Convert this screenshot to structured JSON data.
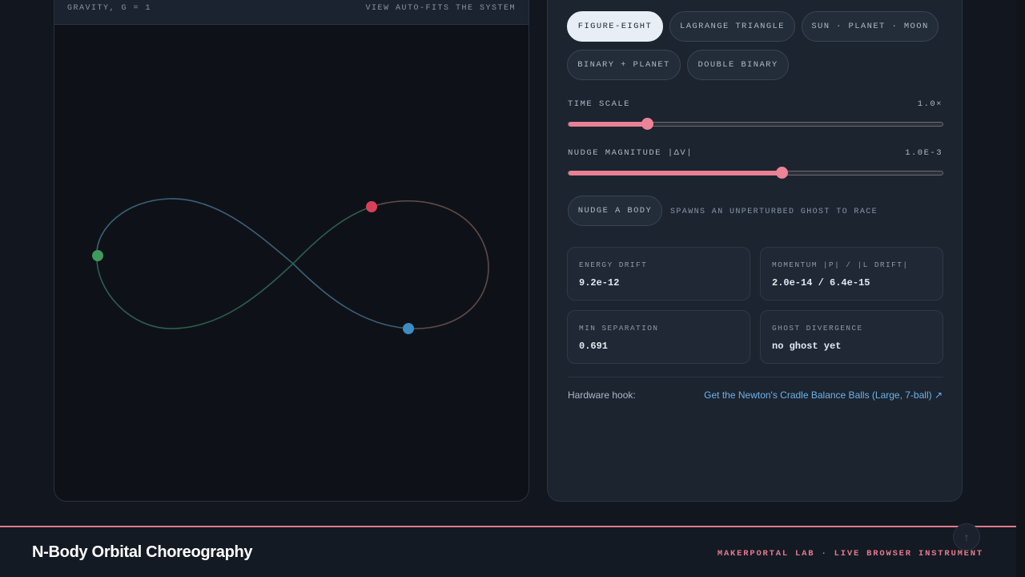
{
  "canvas": {
    "gravity_label": "GRAVITY, G = 1",
    "view_label": "VIEW AUTO-FITS THE SYSTEM",
    "bodies": [
      {
        "name": "red",
        "color": "#d8405a"
      },
      {
        "name": "green",
        "color": "#3e9b5c"
      },
      {
        "name": "blue",
        "color": "#3b8dc4"
      }
    ]
  },
  "presets": {
    "figure_eight": "FIGURE-EIGHT",
    "lagrange_triangle": "LAGRANGE TRIANGLE",
    "sun_planet_moon": "SUN · PLANET · MOON",
    "binary_planet": "BINARY + PLANET",
    "double_binary": "DOUBLE BINARY",
    "active": "FIGURE-EIGHT"
  },
  "sliders": {
    "time_scale": {
      "label": "TIME SCALE",
      "value_text": "1.0×",
      "fraction": 0.21
    },
    "nudge_magnitude": {
      "label": "NUDGE MAGNITUDE |ΔV|",
      "value_text": "1.0E-3",
      "fraction": 0.57
    }
  },
  "nudge": {
    "button_label": "NUDGE A BODY",
    "note": "SPAWNS AN UNPERTURBED GHOST TO RACE"
  },
  "stats": {
    "energy_drift": {
      "label": "ENERGY DRIFT",
      "value": "9.2e-12"
    },
    "momentum": {
      "label": "MOMENTUM |P| / |L DRIFT|",
      "value": "2.0e-14 / 6.4e-15"
    },
    "min_separation": {
      "label": "MIN SEPARATION",
      "value": "0.691"
    },
    "ghost_divergence": {
      "label": "GHOST DIVERGENCE",
      "value": "no ghost yet"
    }
  },
  "hardware": {
    "label": "Hardware hook:",
    "link_text": "Get the Newton's Cradle Balance Balls (Large, 7-ball) ↗"
  },
  "footer": {
    "title": "N-Body Orbital Choreography",
    "credit": "MAKERPORTAL LAB · LIVE BROWSER INSTRUMENT"
  },
  "colors": {
    "accent": "#e07a8c",
    "link": "#6bb3e8",
    "orbit_blue": "#3d5f7a",
    "orbit_green": "#2e5e4f",
    "orbit_brown": "#5e4a48"
  },
  "icons": {
    "scroll_top": "arrow-up-icon"
  }
}
